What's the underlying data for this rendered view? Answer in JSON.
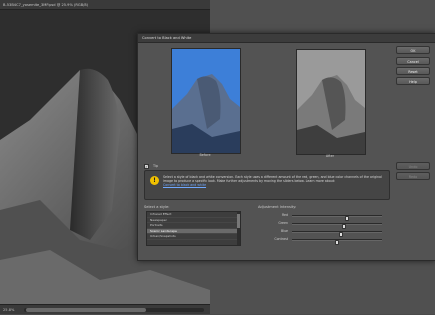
{
  "document": {
    "title": "B-53B4C7_yosemite_3MP.psd @ 25.9% (RGB/8)",
    "status_zoom": "25.8%"
  },
  "dialog": {
    "title": "Convert to Black and White",
    "before_caption": "Before",
    "after_caption": "After",
    "buttons": {
      "ok": "OK",
      "cancel": "Cancel",
      "reset": "Reset",
      "undo": "Undo",
      "redo": "Redo",
      "help": "Help"
    },
    "tip": {
      "label": "Tip",
      "checked": true,
      "text": "Select a style of black and white conversion. Each style uses a different amount of the red, green, and blue color channels of the original image to produce a specific look. Make further adjustments by moving the sliders below. Learn more about:",
      "link": "Convert to black and white"
    },
    "style_label": "Select a style:",
    "styles": [
      {
        "name": "Infrared Effect",
        "selected": false
      },
      {
        "name": "Newspaper",
        "selected": false
      },
      {
        "name": "Portraits",
        "selected": false
      },
      {
        "name": "Scenic Landscape",
        "selected": true
      },
      {
        "name": "Urban/Snapshots",
        "selected": false
      }
    ],
    "adjust_label": "Adjustment Intensity:",
    "sliders": [
      {
        "name": "Red",
        "value": 0.62
      },
      {
        "name": "Green",
        "value": 0.58
      },
      {
        "name": "Blue",
        "value": 0.55
      },
      {
        "name": "Contrast",
        "value": 0.5
      }
    ]
  }
}
